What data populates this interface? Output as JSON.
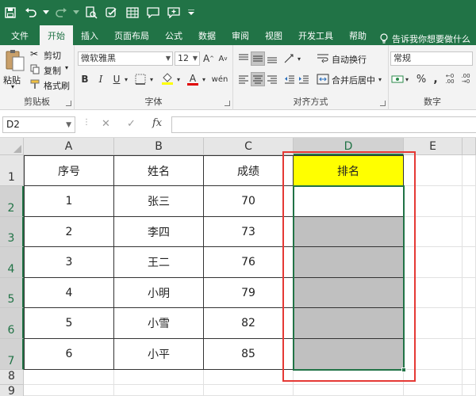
{
  "ribbon_tabs": [
    "文件",
    "开始",
    "插入",
    "页面布局",
    "公式",
    "数据",
    "审阅",
    "视图",
    "开发工具",
    "帮助"
  ],
  "tell_me": "告诉我你想要做什么",
  "clipboard": {
    "paste": "粘贴",
    "cut": "剪切",
    "copy": "复制",
    "format_painter": "格式刷",
    "group": "剪贴板"
  },
  "font": {
    "name": "微软雅黑",
    "size": "12",
    "grow": "A",
    "shrink": "A",
    "bold": "B",
    "italic": "I",
    "underline": "U",
    "color_letter": "A",
    "group": "字体"
  },
  "alignment": {
    "wrap": "自动换行",
    "merge": "合并后居中",
    "group": "对齐方式"
  },
  "number": {
    "format": "常规",
    "percent": "%",
    "comma": ",",
    "group": "数字"
  },
  "formula_bar": {
    "name_box": "D2",
    "fx": "fx",
    "cancel": "✕",
    "enter": "✓"
  },
  "columns": [
    "A",
    "B",
    "C",
    "D",
    "E"
  ],
  "rows": [
    "1",
    "2",
    "3",
    "4",
    "5",
    "6",
    "7",
    "8",
    "9"
  ],
  "table": {
    "headers": [
      "序号",
      "姓名",
      "成绩",
      "排名"
    ],
    "data": [
      [
        "1",
        "张三",
        "70",
        ""
      ],
      [
        "2",
        "李四",
        "73",
        ""
      ],
      [
        "3",
        "王二",
        "76",
        ""
      ],
      [
        "4",
        "小明",
        "79",
        ""
      ],
      [
        "5",
        "小雪",
        "82",
        ""
      ],
      [
        "6",
        "小平",
        "85",
        ""
      ]
    ]
  },
  "colors": {
    "excel_green": "#217346",
    "header_yellow": "#ffff00",
    "highlight_red": "#e53935",
    "range_grey": "#c0c0c0"
  }
}
